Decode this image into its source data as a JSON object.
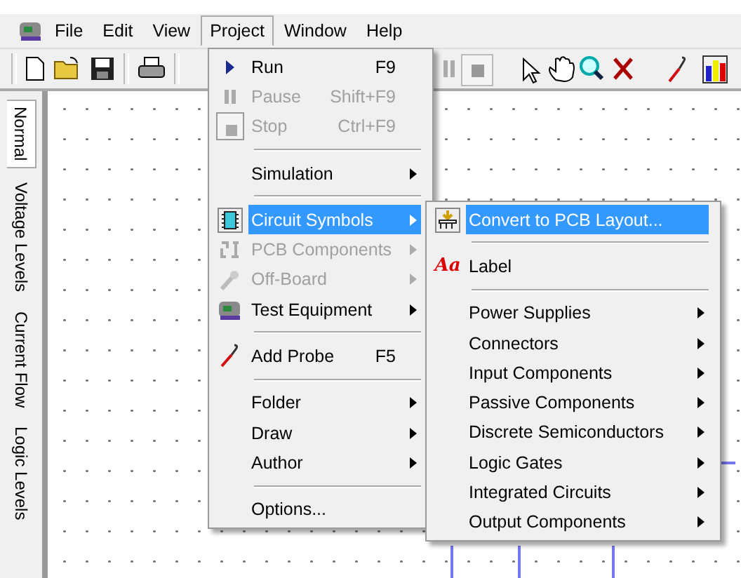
{
  "menubar": [
    {
      "label": "File",
      "selected": false
    },
    {
      "label": "Edit",
      "selected": false
    },
    {
      "label": "View",
      "selected": false
    },
    {
      "label": "Project",
      "selected": true
    },
    {
      "label": "Window",
      "selected": false
    },
    {
      "label": "Help",
      "selected": false
    }
  ],
  "side_tabs": [
    {
      "label": "Normal",
      "selected": true
    },
    {
      "label": "Voltage Levels",
      "selected": false
    },
    {
      "label": "Current Flow",
      "selected": false
    },
    {
      "label": "Logic Levels",
      "selected": false
    }
  ],
  "project_menu": [
    {
      "kind": "item",
      "label": "Run",
      "shortcut": "F9",
      "disabled": false,
      "selected": false,
      "submenu": false
    },
    {
      "kind": "item",
      "label": "Pause",
      "shortcut": "Shift+F9",
      "disabled": true,
      "selected": false,
      "submenu": false
    },
    {
      "kind": "item",
      "label": "Stop",
      "shortcut": "Ctrl+F9",
      "disabled": true,
      "selected": false,
      "submenu": false
    },
    {
      "kind": "separator"
    },
    {
      "kind": "item",
      "label": "Simulation",
      "disabled": false,
      "selected": false,
      "submenu": true
    },
    {
      "kind": "separator"
    },
    {
      "kind": "item",
      "label": "Circuit Symbols",
      "disabled": false,
      "selected": true,
      "submenu": true
    },
    {
      "kind": "item",
      "label": "PCB Components",
      "disabled": true,
      "selected": false,
      "submenu": true
    },
    {
      "kind": "item",
      "label": "Off-Board",
      "disabled": true,
      "selected": false,
      "submenu": true
    },
    {
      "kind": "item",
      "label": "Test Equipment",
      "disabled": false,
      "selected": false,
      "submenu": true
    },
    {
      "kind": "separator"
    },
    {
      "kind": "item",
      "label": "Add Probe",
      "shortcut": "F5",
      "disabled": false,
      "selected": false,
      "submenu": false
    },
    {
      "kind": "separator"
    },
    {
      "kind": "item",
      "label": "Folder",
      "disabled": false,
      "selected": false,
      "submenu": true
    },
    {
      "kind": "item",
      "label": "Draw",
      "disabled": false,
      "selected": false,
      "submenu": true
    },
    {
      "kind": "item",
      "label": "Author",
      "disabled": false,
      "selected": false,
      "submenu": true
    },
    {
      "kind": "separator"
    },
    {
      "kind": "item",
      "label": "Options...",
      "disabled": false,
      "selected": false,
      "submenu": false
    }
  ],
  "circuit_symbols_menu": [
    {
      "kind": "item",
      "label": "Convert to PCB Layout...",
      "disabled": false,
      "selected": true,
      "submenu": false
    },
    {
      "kind": "separator"
    },
    {
      "kind": "item",
      "icon_text": "Aa",
      "label": "Label",
      "disabled": false,
      "selected": false,
      "submenu": false
    },
    {
      "kind": "separator"
    },
    {
      "kind": "item",
      "label": "Power Supplies",
      "disabled": false,
      "selected": false,
      "submenu": true
    },
    {
      "kind": "item",
      "label": "Connectors",
      "disabled": false,
      "selected": false,
      "submenu": true
    },
    {
      "kind": "item",
      "label": "Input Components",
      "disabled": false,
      "selected": false,
      "submenu": true
    },
    {
      "kind": "item",
      "label": "Passive Components",
      "disabled": false,
      "selected": false,
      "submenu": true
    },
    {
      "kind": "item",
      "label": "Discrete Semiconductors",
      "disabled": false,
      "selected": false,
      "submenu": true
    },
    {
      "kind": "item",
      "label": "Logic Gates",
      "disabled": false,
      "selected": false,
      "submenu": true
    },
    {
      "kind": "item",
      "label": "Integrated Circuits",
      "disabled": false,
      "selected": false,
      "submenu": true
    },
    {
      "kind": "item",
      "label": "Output Components",
      "disabled": false,
      "selected": false,
      "submenu": true
    }
  ]
}
